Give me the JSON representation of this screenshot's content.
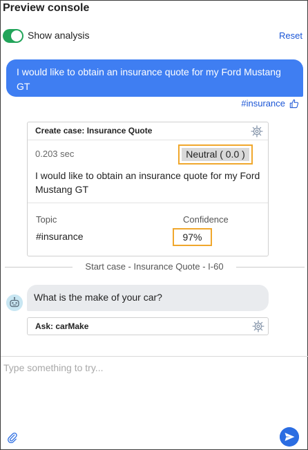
{
  "header": {
    "title": "Preview console"
  },
  "controls": {
    "toggle_label": "Show analysis",
    "toggle_on": true,
    "reset_label": "Reset"
  },
  "colors": {
    "accent": "#3f7ef2",
    "toggle": "#22a45a",
    "highlight": "#f0a72c",
    "link": "#1a55d6"
  },
  "messages": {
    "user_text": "I would like to obtain an insurance quote for my Ford Mustang GT",
    "user_tag": "#insurance",
    "bot_text": "What is the make of your car?"
  },
  "analysis": {
    "header_label": "Create case:  Insurance Quote",
    "time": "0.203 sec",
    "sentiment": "Neutral ( 0.0 )",
    "text": "I would like to obtain an insurance quote for my Ford Mustang GT",
    "topic_header": "Topic",
    "confidence_header": "Confidence",
    "topic_value": "#insurance",
    "confidence_value": "97%"
  },
  "divider_text": "Start case - Insurance Quote - I-60",
  "ask": {
    "label": "Ask:  carMake"
  },
  "input": {
    "placeholder": "Type something to try..."
  },
  "icons": {
    "thumb": "thumbs-up-icon",
    "gear": "gear-icon",
    "bot": "bot-icon",
    "attach": "paperclip-icon",
    "send": "send-icon"
  }
}
